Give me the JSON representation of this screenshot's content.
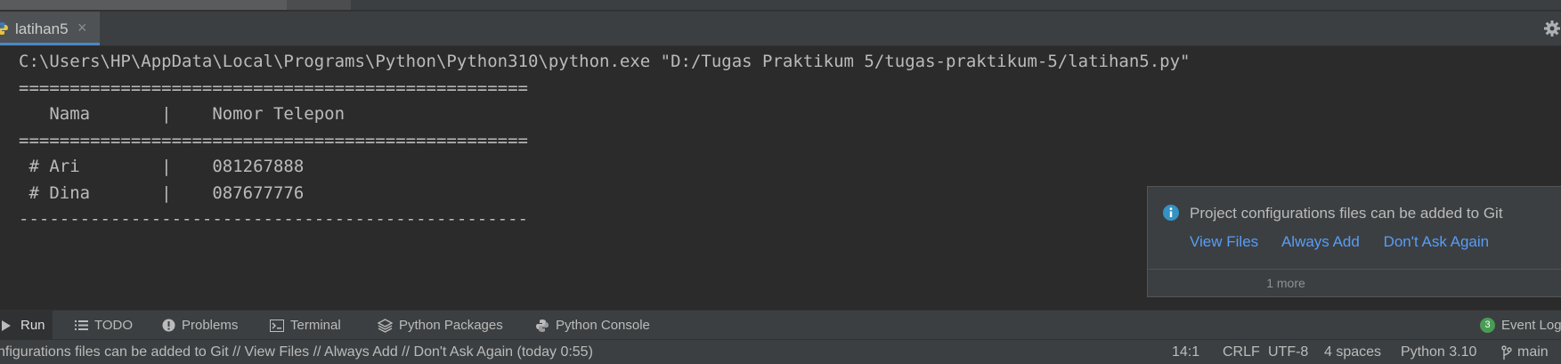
{
  "run_tab": {
    "label": "latihan5",
    "close": "×",
    "icon": "python-icon"
  },
  "console": {
    "lines": [
      "C:\\Users\\HP\\AppData\\Local\\Programs\\Python\\Python310\\python.exe \"D:/Tugas Praktikum 5/tugas-praktikum-5/latihan5.py\"",
      "==================================================",
      "   Nama       |    Nomor Telepon",
      "==================================================",
      " # Ari        |    081267888",
      " # Dina       |    087677776",
      "--------------------------------------------------"
    ]
  },
  "notification": {
    "message": "Project configurations files can be added to Git",
    "actions": [
      "View Files",
      "Always Add",
      "Don't Ask Again"
    ],
    "more": "1 more",
    "icon": "info-icon"
  },
  "tool_windows": [
    {
      "label": "Run",
      "icon": "play-icon",
      "active": true
    },
    {
      "label": "TODO",
      "icon": "list-icon"
    },
    {
      "label": "Problems",
      "icon": "alert-icon"
    },
    {
      "label": "Terminal",
      "icon": "terminal-icon"
    },
    {
      "label": "Python Packages",
      "icon": "layers-icon"
    },
    {
      "label": "Python Console",
      "icon": "python-icon"
    }
  ],
  "event_log": {
    "label": "Event Log",
    "count": "3"
  },
  "status_bar": {
    "message": "nfigurations files can be added to Git // View Files // Always Add // Don't Ask Again (today 0:55)",
    "position": "14:1",
    "line_separator": "CRLF",
    "encoding": "UTF-8",
    "indent": "4 spaces",
    "interpreter": "Python 3.10",
    "branch": "main"
  },
  "colors": {
    "background": "#2b2b2b",
    "panel": "#3c3f41",
    "link": "#589df6",
    "accent": "#4a88c7",
    "badge": "#499c54"
  }
}
